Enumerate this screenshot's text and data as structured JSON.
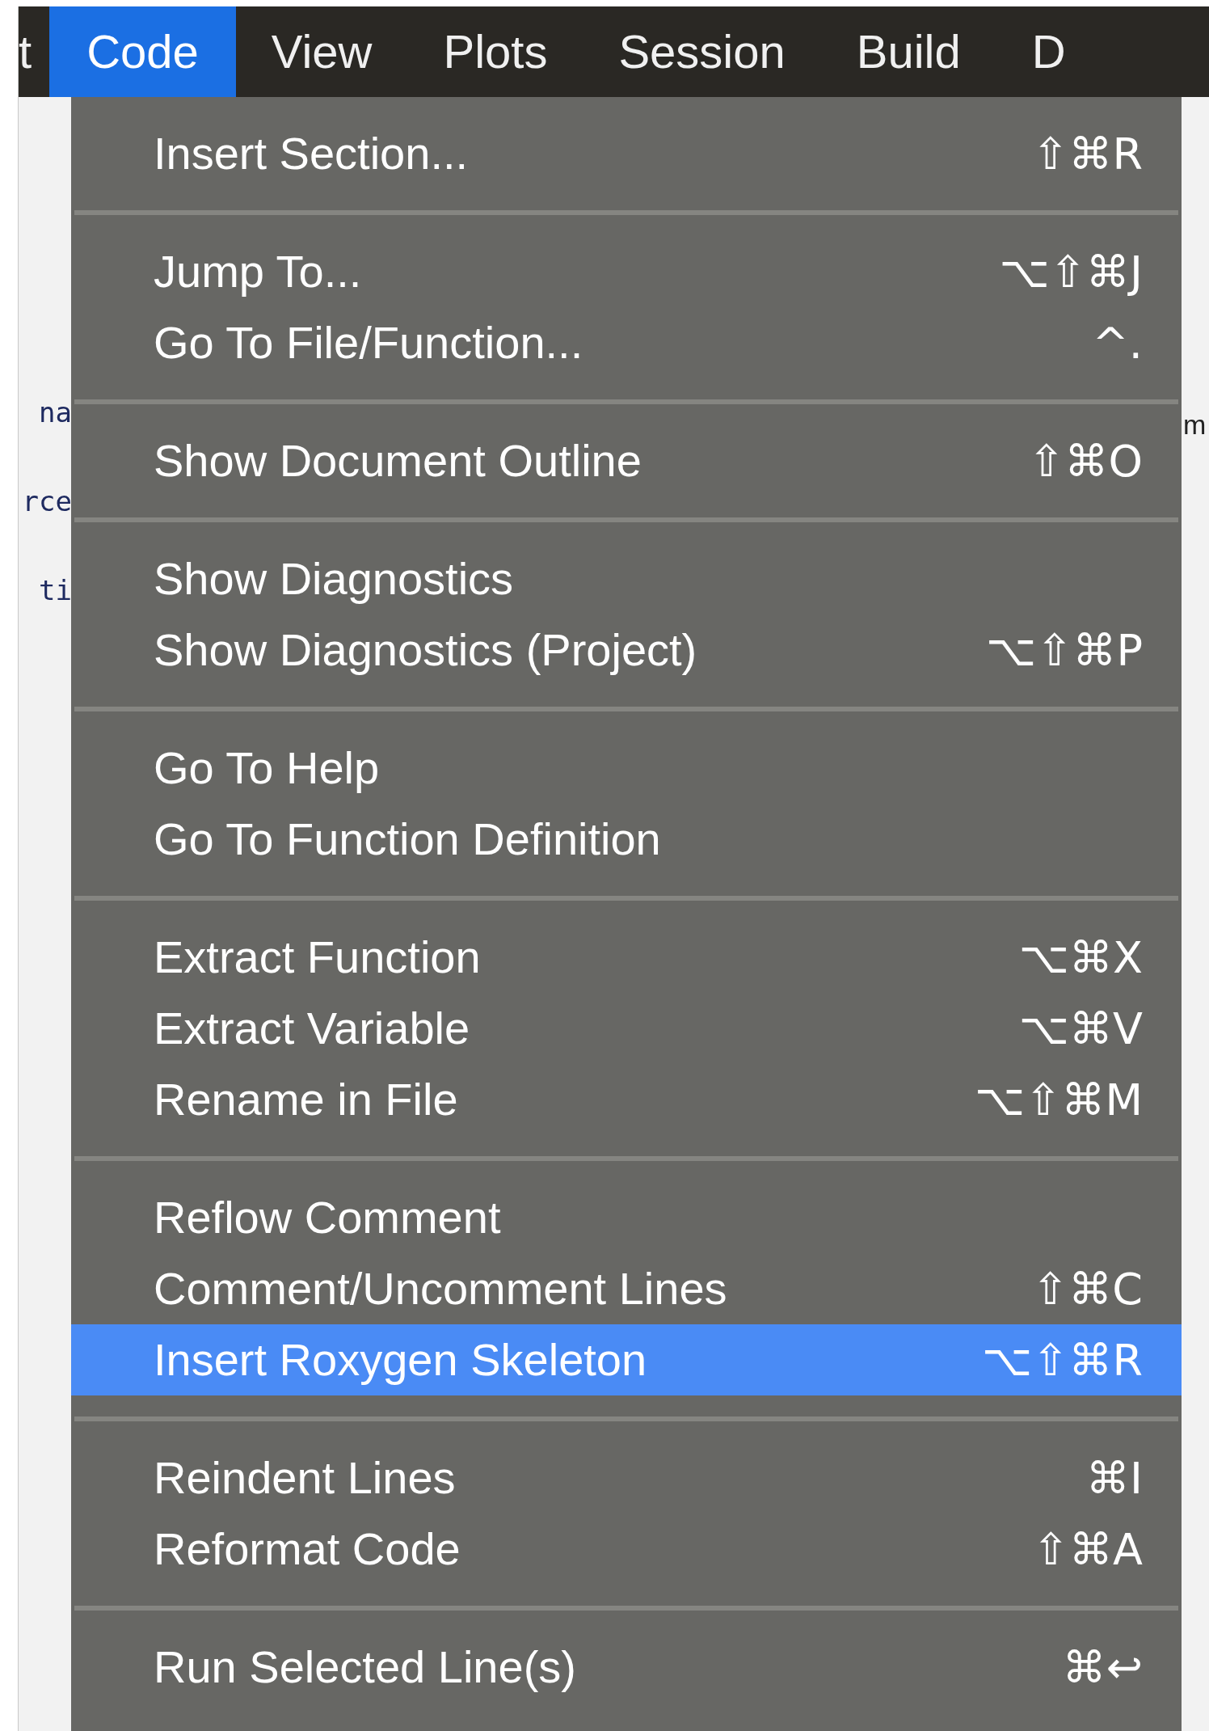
{
  "menu_bar": [
    {
      "label": "t",
      "selected": false
    },
    {
      "label": "Code",
      "selected": true
    },
    {
      "label": "View",
      "selected": false
    },
    {
      "label": "Plots",
      "selected": false
    },
    {
      "label": "Session",
      "selected": false
    },
    {
      "label": "Build",
      "selected": false
    },
    {
      "label": "D",
      "selected": false
    }
  ],
  "background_left": [
    "na",
    "rce",
    "ti"
  ],
  "background_right": [
    "m"
  ],
  "menu": {
    "sections": [
      {
        "items": [
          {
            "label": "Insert Section...",
            "shortcut": "⇧⌘R",
            "selected": false
          }
        ]
      },
      {
        "items": [
          {
            "label": "Jump To...",
            "shortcut": "⌥⇧⌘J",
            "selected": false
          },
          {
            "label": "Go To File/Function...",
            "shortcut": "^.",
            "selected": false
          }
        ]
      },
      {
        "items": [
          {
            "label": "Show Document Outline",
            "shortcut": "⇧⌘O",
            "selected": false
          }
        ]
      },
      {
        "items": [
          {
            "label": "Show Diagnostics",
            "selected": false
          },
          {
            "label": "Show Diagnostics (Project)",
            "shortcut": "⌥⇧⌘P",
            "selected": false
          }
        ]
      },
      {
        "items": [
          {
            "label": "Go To Help",
            "selected": false
          },
          {
            "label": "Go To Function Definition",
            "selected": false
          }
        ]
      },
      {
        "items": [
          {
            "label": "Extract Function",
            "shortcut": "⌥⌘X",
            "selected": false
          },
          {
            "label": "Extract Variable",
            "shortcut": "⌥⌘V",
            "selected": false
          },
          {
            "label": "Rename in File",
            "shortcut": "⌥⇧⌘M",
            "selected": false
          }
        ]
      },
      {
        "items": [
          {
            "label": "Reflow Comment",
            "selected": false
          },
          {
            "label": "Comment/Uncomment Lines",
            "shortcut": "⇧⌘C",
            "selected": false
          },
          {
            "label": "Insert Roxygen Skeleton",
            "shortcut": "⌥⇧⌘R",
            "selected": true
          }
        ]
      },
      {
        "items": [
          {
            "label": "Reindent Lines",
            "shortcut": "⌘I",
            "selected": false
          },
          {
            "label": "Reformat Code",
            "shortcut": "⇧⌘A",
            "selected": false
          }
        ]
      },
      {
        "items": [
          {
            "label": "Run Selected Line(s)",
            "shortcut": "⌘↩",
            "selected": false
          }
        ]
      }
    ]
  }
}
